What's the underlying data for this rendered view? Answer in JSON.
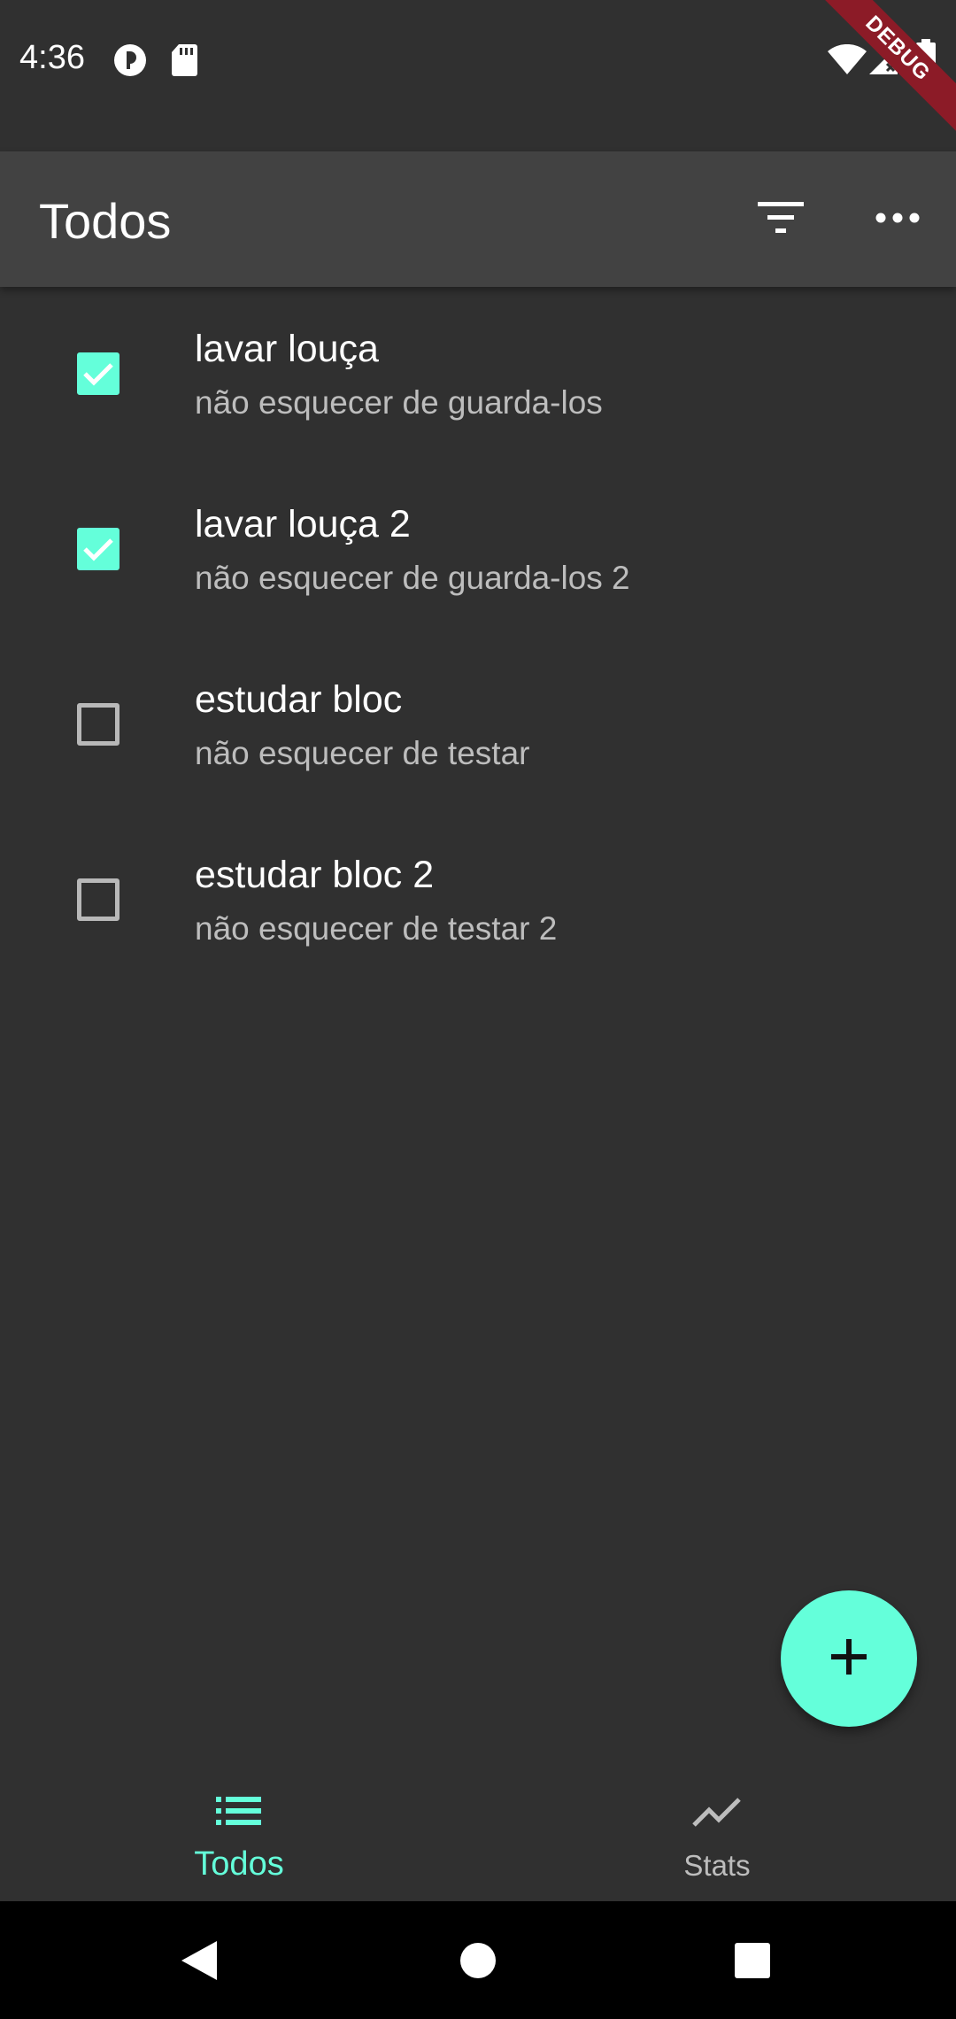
{
  "status_bar": {
    "time": "4:36",
    "left_icons": [
      "sync-icon",
      "sd-card-icon"
    ],
    "right_icons": [
      "wifi-icon",
      "signal-icon",
      "battery-icon"
    ],
    "debug_label": "DEBUG"
  },
  "app_bar": {
    "title": "Todos",
    "actions": [
      "filter-icon",
      "more-horiz-icon"
    ]
  },
  "todos": [
    {
      "title": "lavar louça",
      "subtitle": "não esquecer de guarda-los",
      "checked": true
    },
    {
      "title": "lavar louça 2",
      "subtitle": "não esquecer de guarda-los 2",
      "checked": true
    },
    {
      "title": "estudar bloc",
      "subtitle": "não esquecer de testar",
      "checked": false
    },
    {
      "title": "estudar bloc 2",
      "subtitle": "não esquecer de testar 2",
      "checked": false
    }
  ],
  "fab": {
    "icon": "add-icon"
  },
  "bottom_nav": {
    "items": [
      {
        "label": "Todos",
        "icon": "list-icon",
        "active": true
      },
      {
        "label": "Stats",
        "icon": "show-chart-icon",
        "active": false
      }
    ]
  },
  "system_nav": {
    "buttons": [
      "back-icon",
      "home-icon",
      "recents-icon"
    ]
  },
  "colors": {
    "accent": "#64ffda",
    "background": "#303030",
    "app_bar": "#424242",
    "subtitle": "#bdbdbd",
    "debug_banner": "#8c1b27"
  }
}
